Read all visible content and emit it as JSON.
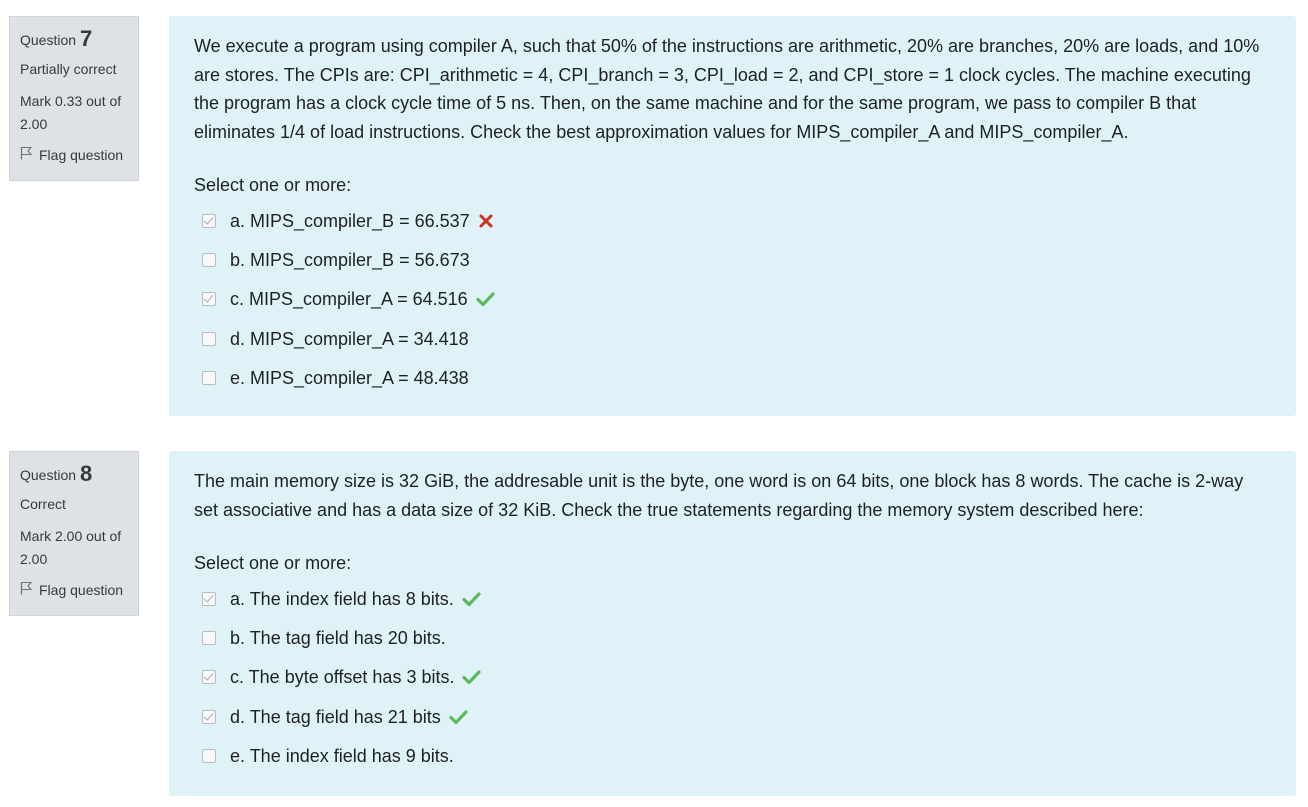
{
  "questions": [
    {
      "question_label": "Question",
      "number": "7",
      "state": "Partially correct",
      "grade": "Mark 0.33 out of 2.00",
      "flag_label": "Flag question",
      "text": "We execute a program using compiler A, such that 50% of the instructions are arithmetic, 20% are branches, 20% are loads, and 10% are stores. The CPIs are: CPI_arithmetic = 4, CPI_branch = 3, CPI_load = 2, and CPI_store = 1 clock cycles. The machine executing the program has a clock cycle time of 5 ns. Then, on the same machine and for the same program, we pass to compiler B that eliminates 1/4 of load instructions. Check the best approximation values for MIPS_compiler_A and MIPS_compiler_A.",
      "prompt": "Select one or more:",
      "answers": [
        {
          "label": "a. MIPS_compiler_B = 66.537",
          "checked": true,
          "feedback": "incorrect"
        },
        {
          "label": "b. MIPS_compiler_B = 56.673",
          "checked": false,
          "feedback": ""
        },
        {
          "label": "c. MIPS_compiler_A = 64.516",
          "checked": true,
          "feedback": "correct"
        },
        {
          "label": "d. MIPS_compiler_A = 34.418",
          "checked": false,
          "feedback": ""
        },
        {
          "label": "e. MIPS_compiler_A = 48.438",
          "checked": false,
          "feedback": ""
        }
      ]
    },
    {
      "question_label": "Question",
      "number": "8",
      "state": "Correct",
      "grade": "Mark 2.00 out of 2.00",
      "flag_label": "Flag question",
      "text": "The main memory size is 32 GiB, the addresable unit is the byte, one word is on 64 bits, one block has 8 words. The cache is 2-way set associative and has a data size of 32 KiB. Check the true statements regarding the memory system described here:",
      "prompt": "Select one or more:",
      "answers": [
        {
          "label": "a. The index field has 8 bits.",
          "checked": true,
          "feedback": "correct"
        },
        {
          "label": "b. The tag field has 20 bits.",
          "checked": false,
          "feedback": ""
        },
        {
          "label": "c. The byte offset has 3 bits.",
          "checked": true,
          "feedback": "correct"
        },
        {
          "label": "d. The tag field has 21 bits",
          "checked": true,
          "feedback": "correct"
        },
        {
          "label": "e. The index field has 9 bits.",
          "checked": false,
          "feedback": ""
        }
      ]
    }
  ],
  "colors": {
    "correct": "#5cb85c",
    "incorrect": "#ca3120",
    "content_bg": "#def2f8",
    "info_bg": "#dee2e6"
  },
  "icons": {
    "correct": "check-icon",
    "incorrect": "cross-icon",
    "flag": "flag-icon"
  }
}
